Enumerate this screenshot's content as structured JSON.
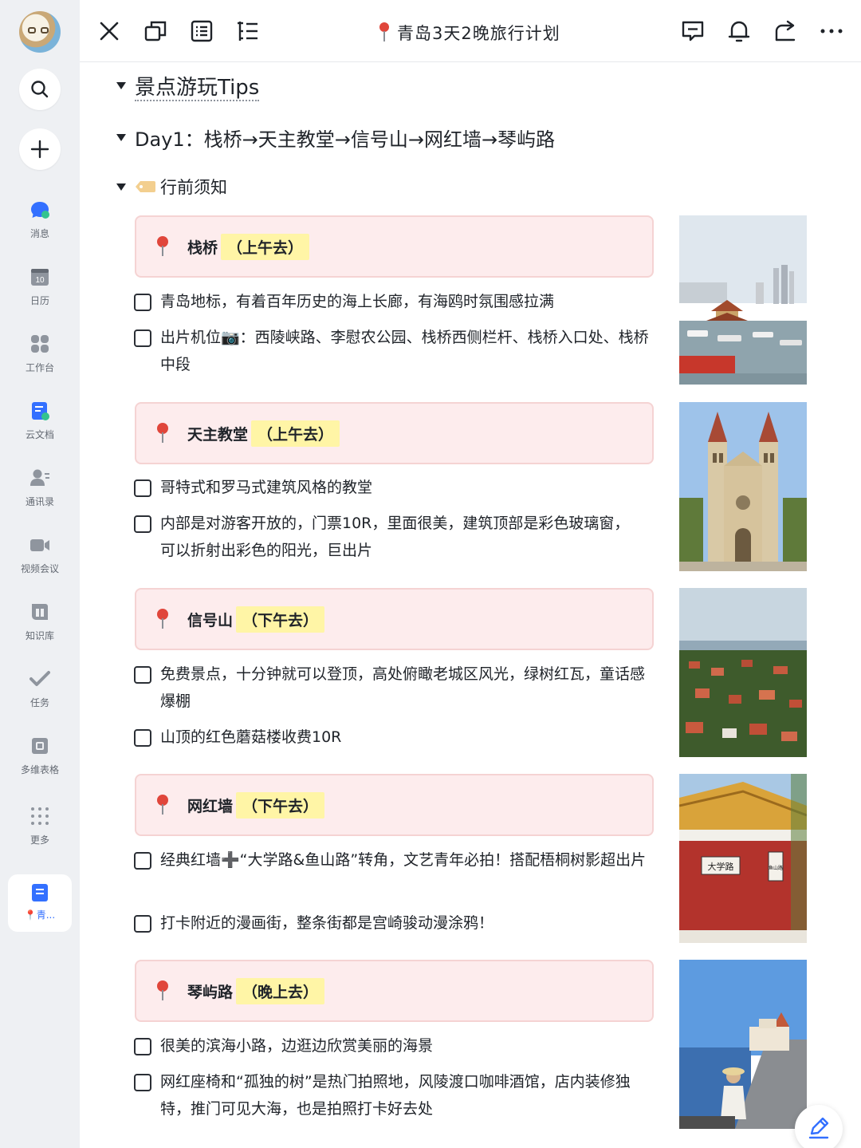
{
  "sidebar": {
    "items": [
      {
        "label": "消息"
      },
      {
        "label": "日历"
      },
      {
        "label": "工作台"
      },
      {
        "label": "云文档"
      },
      {
        "label": "通讯录"
      },
      {
        "label": "视频会议"
      },
      {
        "label": "知识库"
      },
      {
        "label": "任务"
      },
      {
        "label": "多维表格"
      },
      {
        "label": "更多"
      }
    ],
    "calendar_day": "10",
    "active_doc": {
      "label": "📍青..."
    }
  },
  "topbar": {
    "title": "青岛3天2晚旅行计划"
  },
  "doc": {
    "h1": "景点游玩Tips",
    "h2": "Day1：栈桥→天主教堂→信号山→网红墙→琴屿路",
    "h3": "行前须知",
    "spots": [
      {
        "name": "栈桥",
        "time": "（上午去）",
        "todos": [
          "青岛地标，有着百年历史的海上长廊，有海鸥时氛围感拉满",
          "出片机位📷：西陵峡路、李慰农公园、栈桥西侧栏杆、栈桥入口处、栈桥中段"
        ]
      },
      {
        "name": "天主教堂",
        "time": "（上午去）",
        "todos": [
          "哥特式和罗马式建筑风格的教堂",
          "内部是对游客开放的，门票10R，里面很美，建筑顶部是彩色玻璃窗，可以折射出彩色的阳光，巨出片"
        ]
      },
      {
        "name": "信号山",
        "time": "（下午去）",
        "todos": [
          "免费景点，十分钟就可以登顶，高处俯瞰老城区风光，绿树红瓦，童话感爆棚",
          "山顶的红色蘑菇楼收费10R"
        ]
      },
      {
        "name": "网红墙",
        "time": "（下午去）",
        "todos": [
          "经典红墙➕“大学路&鱼山路”转角，文艺青年必拍！搭配梧桐树影超出片",
          "打卡附近的漫画街，整条街都是宫崎骏动漫涂鸦！"
        ]
      },
      {
        "name": "琴屿路",
        "time": "（晚上去）",
        "todos": [
          "很美的滨海小路，边逛边欣赏美丽的海景",
          "网红座椅和“孤独的树”是热门拍照地，风陵渡口咖啡酒馆，店内装修独特，推门可见大海，也是拍照打卡好去处"
        ]
      }
    ],
    "photo_signs": {
      "wall_sign": "大学路",
      "wall_sign_small": "鱼山路"
    }
  }
}
